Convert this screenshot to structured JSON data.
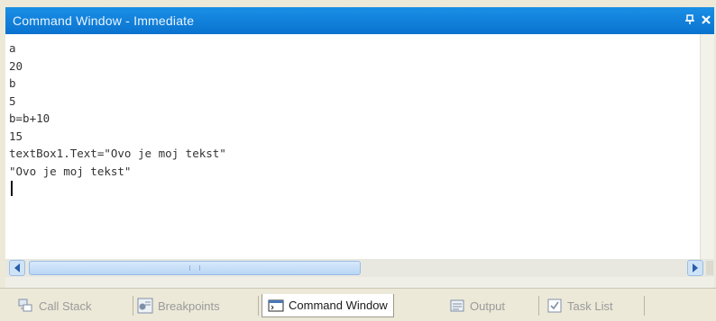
{
  "window": {
    "title": "Command Window - Immediate",
    "pin_icon": "pin-icon",
    "close_icon": "close-icon"
  },
  "console": {
    "lines": [
      "a",
      "20",
      "b",
      "5",
      "b=b+10",
      "15",
      "textBox1.Text=\"Ovo je moj tekst\"",
      "\"Ovo je moj tekst\""
    ]
  },
  "scrollbar": {
    "left_icon": "arrow-left-icon",
    "right_icon": "arrow-right-icon",
    "position_fraction": 0
  },
  "tabs": [
    {
      "label": "Call Stack",
      "icon": "call-stack-icon",
      "active": false
    },
    {
      "label": "Breakpoints",
      "icon": "breakpoints-icon",
      "active": false
    },
    {
      "label": "Command Window",
      "icon": "command-window-icon",
      "active": true
    },
    {
      "label": "Output",
      "icon": "output-icon",
      "active": false
    },
    {
      "label": "Task List",
      "icon": "task-list-icon",
      "active": false
    }
  ],
  "colors": {
    "titlebar": "#0a73cf",
    "tab_inactive_text": "#9a9a9a",
    "tab_active_text": "#1a1a1a"
  }
}
